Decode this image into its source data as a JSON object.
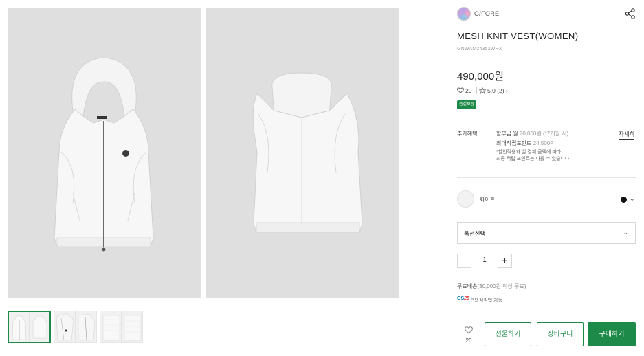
{
  "brand": {
    "name": "G/FORE"
  },
  "product": {
    "title": "MESH KNIT VEST(WOMEN)",
    "code": "GNWAM24352WHX",
    "price": "490,000원",
    "likes": "20",
    "rating": "5.0",
    "review_count": "(2)",
    "badge": "품질보증"
  },
  "benefits": {
    "label": "추가혜택",
    "installment_prefix": "할부금 월",
    "installment_value": "70,000원 (*7개월 시)",
    "points_prefix": "최대적립포인트",
    "points_value": "24,500P",
    "note_line1": "*할인적용과 실 결제 금액에 따라",
    "note_line2": "최종 적립 포인트는 다를 수 있습니다.",
    "detail_link": "자세히"
  },
  "color": {
    "name": "화이트",
    "selected_swatch": "#111111"
  },
  "option_select": {
    "label": "옵션선택"
  },
  "quantity": {
    "value": "1",
    "minus": "−",
    "plus": "+"
  },
  "shipping": {
    "prefix": "무료배송",
    "suffix": "(30,000원 이상 무료)"
  },
  "gs25": {
    "logo_gs": "GS",
    "logo_num": "25",
    "text": "편의점픽업 가능"
  },
  "wishlist": {
    "count": "20"
  },
  "actions": {
    "gift": "선물하기",
    "cart": "장바구니",
    "buy": "구매하기"
  },
  "colors": {
    "accent": "#1e8a49",
    "image_bg": "#dfdfdf"
  }
}
